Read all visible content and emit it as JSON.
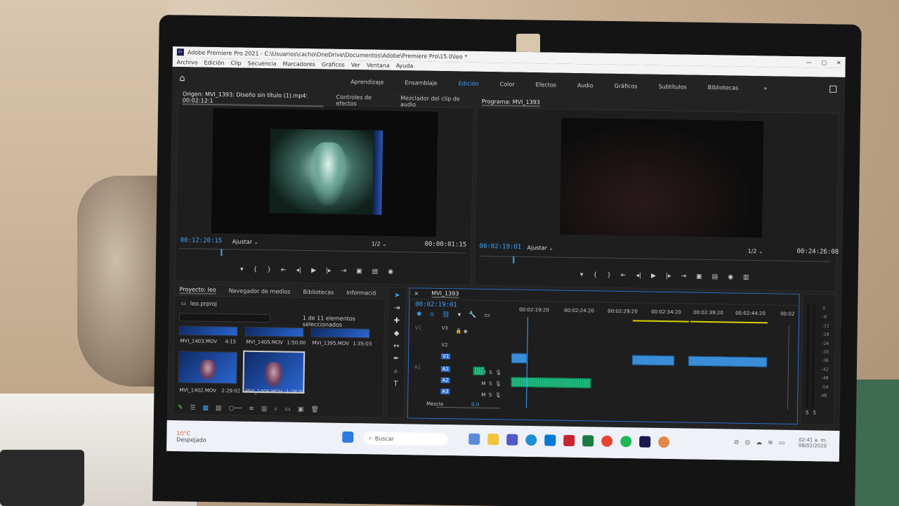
{
  "window": {
    "title": "Adobe Premiere Pro 2021 - C:\\Usuarios\\cacho\\OneDrive\\Documentos\\Adobe\\Premiere Pro\\15.0\\leo *",
    "logo_text": "Pr",
    "controls": [
      "—",
      "▢",
      "✕"
    ]
  },
  "menu": [
    "Archivo",
    "Edición",
    "Clip",
    "Secuencia",
    "Marcadores",
    "Gráficos",
    "Ver",
    "Ventana",
    "Ayuda"
  ],
  "workspaces": {
    "items": [
      "Aprendizaje",
      "Ensamblaje",
      "Edición",
      "Color",
      "Efectos",
      "Audio",
      "Gráficos",
      "Subtítulos",
      "Bibliotecas"
    ],
    "active": "Edición",
    "more": "»"
  },
  "source": {
    "tabs": [
      "Origen: MVI_1393: Diseño sin título (1).mp4: 00:02:12:1",
      "Controles de efectos",
      "Mezclador del clip de audio"
    ],
    "timecode_in": "00:12:20:15",
    "fit": "Ajustar",
    "resolution": "1/2",
    "duration": "00:00:01:15"
  },
  "program": {
    "tab": "Programa: MVI_1393",
    "timecode": "00:02:19:01",
    "fit": "Ajustar",
    "resolution": "1/2",
    "duration": "00:24:26:08"
  },
  "project": {
    "tabs": [
      "Proyecto: leo",
      "Navegador de medios",
      "Bibliotecas",
      "Informació"
    ],
    "file": "leo.prproj",
    "count": "1 de 11 elementos seleccionados",
    "bins": [
      {
        "name": "MVI_1403.MOV",
        "duration": "4:15"
      },
      {
        "name": "MVI_1405.MOV",
        "duration": "1:50:00"
      },
      {
        "name": "MVI_1395.MOV",
        "duration": "1:35:03"
      },
      {
        "name": "MVI_1402.MOV",
        "duration": "2:29:02"
      },
      {
        "name": "MVI_1406.MOV",
        "duration": "1:28:05"
      }
    ]
  },
  "timeline": {
    "tab": "MVI_1393",
    "timecode": "00:02:19:01",
    "ruler": [
      "00:02:19:20",
      "00:02:24:20",
      "00:02:29:20",
      "00:02:34:20",
      "00:02:39:20",
      "00:02:44:20",
      "00:02"
    ],
    "tracks": [
      "V3",
      "V2",
      "V1",
      "A1",
      "A2",
      "A3"
    ],
    "targets": [
      "V1",
      "A1"
    ],
    "mix_label": "Mezcla",
    "mix_value": "0.0"
  },
  "meter": {
    "scale": [
      "0",
      "-6",
      "-12",
      "-18",
      "-24",
      "-30",
      "-36",
      "-42",
      "-48",
      "-54",
      "dB"
    ],
    "solo": [
      "S",
      "S"
    ]
  },
  "taskbar": {
    "weather_temp": "10°C",
    "weather_desc": "Despejado",
    "search_placeholder": "Buscar",
    "clock_time": "02:41 a. m.",
    "clock_date": "08/02/2020"
  },
  "colors": {
    "accent": "#3ea5ff",
    "video_clip": "#3a8ed8",
    "audio_clip": "#1fc184"
  }
}
